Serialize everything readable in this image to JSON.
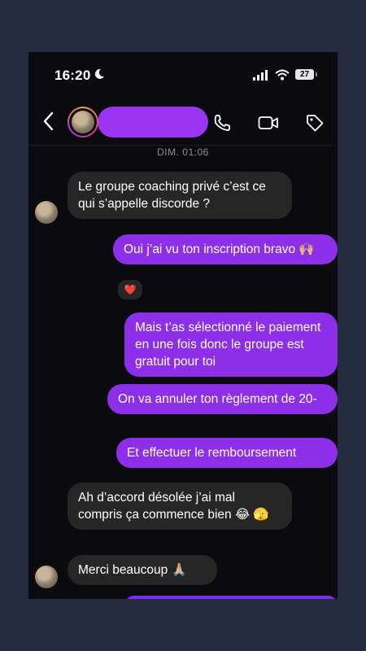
{
  "status_bar": {
    "time": "16:20",
    "battery": "27"
  },
  "conversation": {
    "date_label": "DIM. 01:06",
    "messages": [
      {
        "from": "them",
        "text": "Le groupe coaching privé c’est ce qui s’appelle discorde ?"
      },
      {
        "from": "me",
        "text": "Oui j’ai vu ton inscription bravo 🙌🏼",
        "reaction": "❤️"
      },
      {
        "from": "me",
        "text": "Mais t’as sélectionné le paiement en une fois donc le groupe est gratuit pour toi"
      },
      {
        "from": "me",
        "text": "On va annuler ton règlement de 20-"
      },
      {
        "from": "me",
        "text": "Et effectuer le remboursement"
      },
      {
        "from": "them",
        "text": "Ah d’accord désolée j’ai mal compris ça commence bien 😂 🫣"
      },
      {
        "from": "them",
        "text": "Merci beaucoup 🙏🏼"
      }
    ]
  },
  "colors": {
    "outgoing": "#8d2fe8",
    "incoming": "#262626",
    "background": "#0b0b0f"
  }
}
